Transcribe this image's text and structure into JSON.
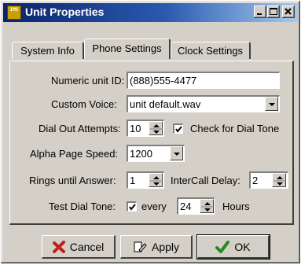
{
  "window": {
    "title": "Unit Properties",
    "app_icon_text": "IMS"
  },
  "tabs": [
    {
      "label": "System Info",
      "active": false
    },
    {
      "label": "Phone Settings",
      "active": true
    },
    {
      "label": "Clock Settings",
      "active": false
    }
  ],
  "form": {
    "unit_id_label": "Numeric unit ID:",
    "unit_id_value": "(888)555-4477",
    "voice_label": "Custom Voice:",
    "voice_value": "unit default.wav",
    "dial_attempts_label": "Dial Out Attempts:",
    "dial_attempts_value": "10",
    "dial_tone_check_label": "Check for Dial Tone",
    "dial_tone_checked": true,
    "page_speed_label": "Alpha Page Speed:",
    "page_speed_value": "1200",
    "rings_label": "Rings until Answer:",
    "rings_value": "1",
    "intercall_label": "InterCall Delay:",
    "intercall_value": "2",
    "test_label": "Test Dial Tone:",
    "test_checked": true,
    "every_label": "every",
    "hours_value": "24",
    "hours_label": "Hours"
  },
  "buttons": {
    "cancel": "Cancel",
    "apply": "Apply",
    "ok": "OK"
  },
  "colors": {
    "titlebar_start": "#0a246a",
    "titlebar_end": "#a6caf0",
    "cancel_icon": "#c0201c",
    "ok_icon": "#2a8a1e",
    "window_face": "#d4d0c8"
  }
}
